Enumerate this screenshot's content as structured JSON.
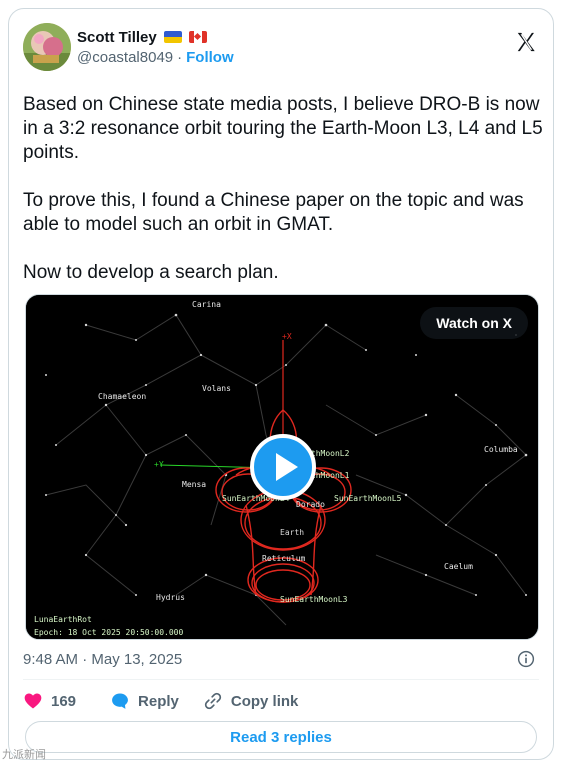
{
  "author": {
    "display_name": "Scott Tilley",
    "handle": "@coastal8049",
    "separator": "·",
    "follow_label": "Follow",
    "flags": [
      "ukraine-flag",
      "canada-flag"
    ]
  },
  "tweet": {
    "text": "Based on Chinese state media posts, I believe DRO-B is now in a 3:2 resonance orbit touring the Earth-Moon L3, L4 and L5 points.\n\nTo prove this, I found a Chinese paper on the topic and was able to model such an orbit in GMAT.\n\nNow to develop a search plan.",
    "timestamp": "9:48 AM · May 13, 2025"
  },
  "media": {
    "watch_label": "Watch on X",
    "overlay_labels": {
      "constellation_carina": "Carina",
      "constellation_chamaeleon": "Chamaeleon",
      "constellation_volans": "Volans",
      "constellation_mensa": "Mensa",
      "constellation_dorado": "Dorado",
      "constellation_reticulum": "Reticulum",
      "constellation_hydrus": "Hydrus",
      "constellation_columba": "Columba",
      "constellation_caelum": "Caelum",
      "label_l2": "SunEarthMoonL2",
      "label_l1": "SunEarthMoonL1",
      "label_l4": "SunEarthMoonL4",
      "label_l5": "SunEarthMoonL5",
      "label_l3": "SunEarthMoonL3",
      "label_earth": "Earth",
      "axis_x": "+X",
      "axis_y": "+Y",
      "frame_label": "LunaEarthRot",
      "epoch_label": "Epoch: 18 Oct 2025 20:50:00.000"
    },
    "colors": {
      "background": "#000000",
      "orbit": "#e0281f",
      "labels": "#e8e8e8",
      "green_labels": "#d8f8c8",
      "constellation_lines": "#3a3a3a",
      "green_axis": "#29d629"
    }
  },
  "actions": {
    "like_count": "169",
    "reply_label": "Reply",
    "copy_link_label": "Copy link",
    "read_replies_label": "Read 3 replies"
  },
  "watermark": "九派新闻"
}
